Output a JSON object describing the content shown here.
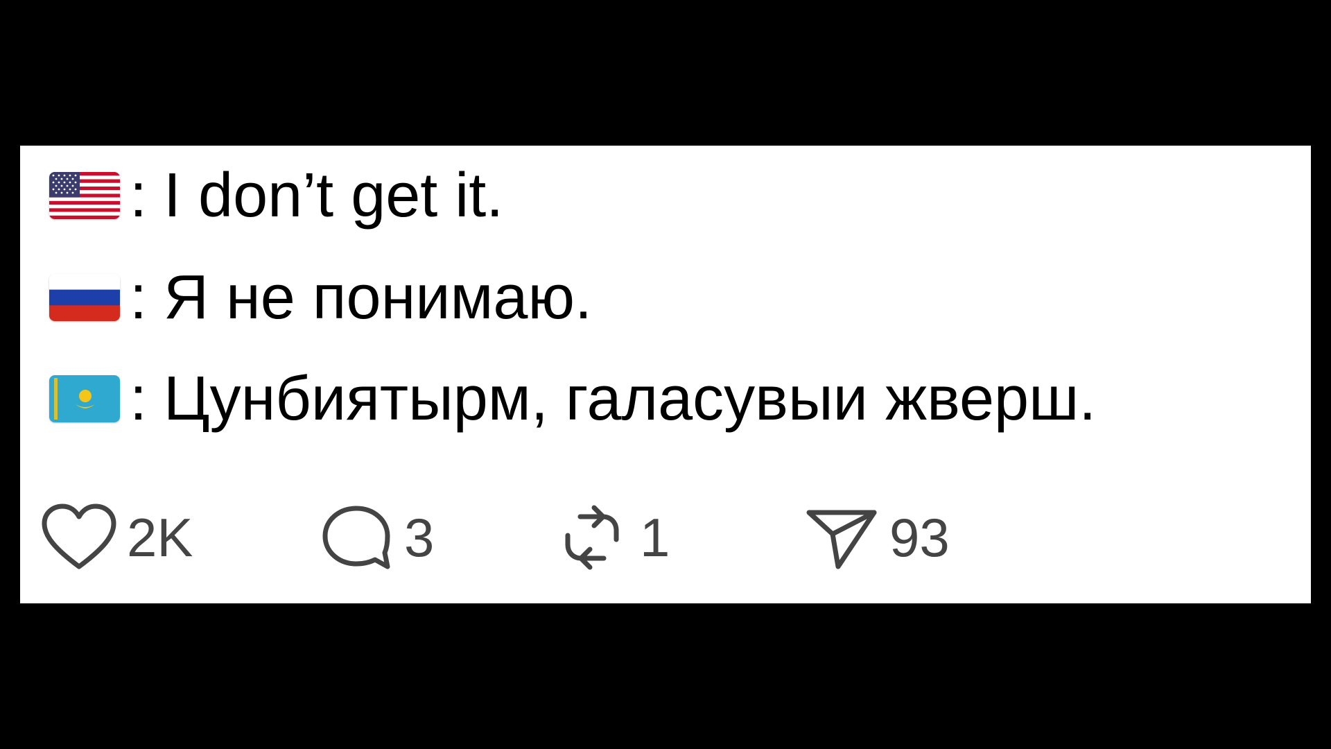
{
  "post": {
    "lines": [
      {
        "flag": "us-flag-icon",
        "colon": ":",
        "text": "I don’t get it."
      },
      {
        "flag": "russia-flag-icon",
        "colon": ":",
        "text": "Я не понимаю."
      },
      {
        "flag": "kazakhstan-flag-icon",
        "colon": ":",
        "text": "Цунбиятырм, галасувыи жверш."
      }
    ],
    "actions": {
      "likes": {
        "icon": "heart-icon",
        "count": "2K"
      },
      "comments": {
        "icon": "comment-icon",
        "count": "3"
      },
      "reposts": {
        "icon": "repost-icon",
        "count": "1"
      },
      "shares": {
        "icon": "send-icon",
        "count": "93"
      }
    }
  },
  "colors": {
    "background": "#000000",
    "card": "#ffffff",
    "text": "#000000",
    "action_text": "#444444"
  }
}
